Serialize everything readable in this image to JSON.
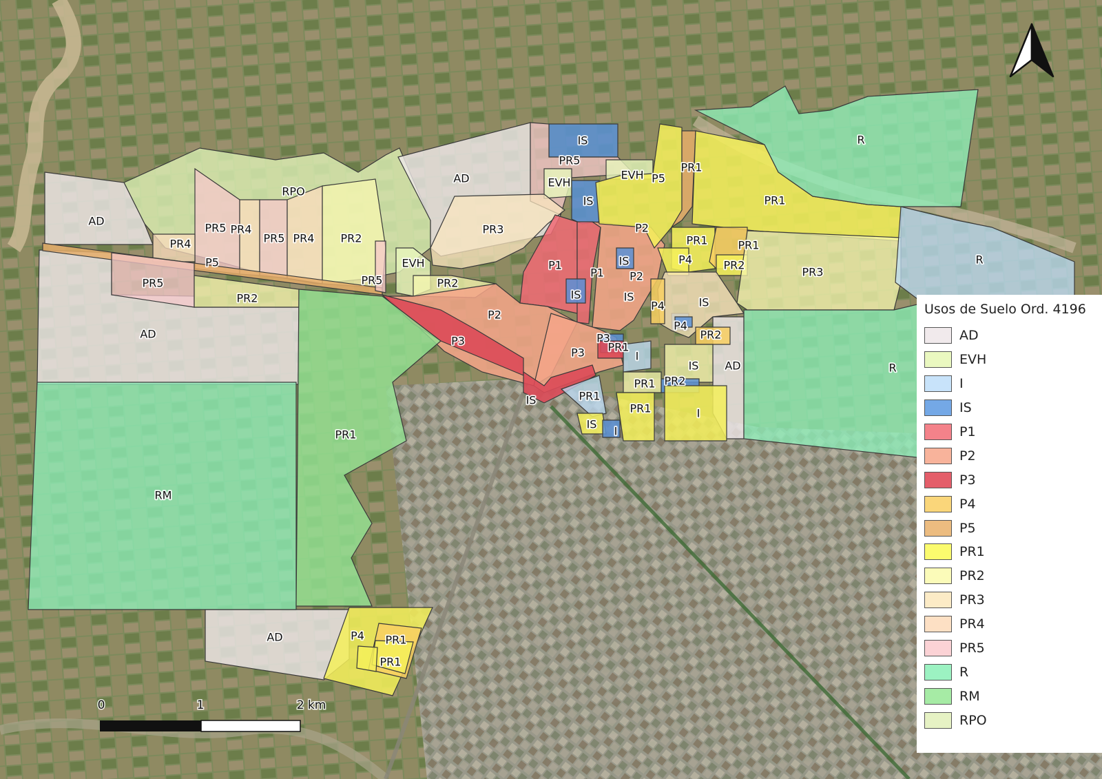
{
  "map": {
    "zones": [
      {
        "code": "RPO",
        "label": "RPO"
      },
      {
        "code": "AD",
        "label": "AD"
      },
      {
        "code": "AD",
        "label": "AD"
      },
      {
        "code": "AD",
        "label": "AD"
      },
      {
        "code": "AD",
        "label": "AD"
      },
      {
        "code": "AD",
        "label": "AD"
      },
      {
        "code": "IS",
        "label": "IS"
      },
      {
        "code": "PR5",
        "label": "PR5"
      },
      {
        "code": "EVH",
        "label": "EVH"
      },
      {
        "code": "EVH",
        "label": "EVH"
      },
      {
        "code": "EVH",
        "label": "EVH"
      },
      {
        "code": "PR5",
        "label": "PR5"
      },
      {
        "code": "PR4",
        "label": "PR4"
      },
      {
        "code": "PR5",
        "label": "PR5"
      },
      {
        "code": "PR4",
        "label": "PR4"
      },
      {
        "code": "PR2",
        "label": "PR2"
      },
      {
        "code": "PR4",
        "label": "PR4"
      },
      {
        "code": "P5",
        "label": "P5"
      },
      {
        "code": "PR5",
        "label": "PR5"
      },
      {
        "code": "PR5",
        "label": "PR5"
      },
      {
        "code": "PR2",
        "label": "PR2"
      },
      {
        "code": "PR2",
        "label": "PR2"
      },
      {
        "code": "PR3",
        "label": "PR3"
      },
      {
        "code": "IS",
        "label": "IS"
      },
      {
        "code": "P1",
        "label": "P1"
      },
      {
        "code": "P1",
        "label": "P1"
      },
      {
        "code": "P2",
        "label": "P2"
      },
      {
        "code": "P2",
        "label": "P2"
      },
      {
        "code": "P2",
        "label": "P2"
      },
      {
        "code": "P3",
        "label": "P3"
      },
      {
        "code": "P3",
        "label": "P3"
      },
      {
        "code": "IS",
        "label": "IS"
      },
      {
        "code": "IS",
        "label": "IS"
      },
      {
        "code": "IS",
        "label": "IS"
      },
      {
        "code": "IS",
        "label": "IS"
      },
      {
        "code": "P3",
        "label": "P3"
      },
      {
        "code": "PR1",
        "label": "PR1"
      },
      {
        "code": "P5",
        "label": "P5"
      },
      {
        "code": "PR1",
        "label": "PR1"
      },
      {
        "code": "PR1",
        "label": "PR1"
      },
      {
        "code": "PR1",
        "label": "PR1"
      },
      {
        "code": "P4",
        "label": "P4"
      },
      {
        "code": "PR1",
        "label": "PR1"
      },
      {
        "code": "PR2",
        "label": "PR2"
      },
      {
        "code": "PR3",
        "label": "PR3"
      },
      {
        "code": "IS",
        "label": "IS"
      },
      {
        "code": "P4",
        "label": "P4"
      },
      {
        "code": "P4",
        "label": "P4"
      },
      {
        "code": "PR2",
        "label": "PR2"
      },
      {
        "code": "IS",
        "label": "IS"
      },
      {
        "code": "PR2",
        "label": "PR2"
      },
      {
        "code": "PR1",
        "label": "PR1"
      },
      {
        "code": "PR1",
        "label": "PR1"
      },
      {
        "code": "I",
        "label": "I"
      },
      {
        "code": "I",
        "label": "I"
      },
      {
        "code": "PR1",
        "label": "PR1"
      },
      {
        "code": "IS",
        "label": "IS"
      },
      {
        "code": "I",
        "label": "I"
      },
      {
        "code": "R",
        "label": "R"
      },
      {
        "code": "R",
        "label": "R"
      },
      {
        "code": "R",
        "label": "R"
      },
      {
        "code": "RM",
        "label": "RM"
      },
      {
        "code": "PR1",
        "label": "PR1"
      },
      {
        "code": "P4",
        "label": "P4"
      },
      {
        "code": "PR1",
        "label": "PR1"
      },
      {
        "code": "PR1",
        "label": "PR1"
      }
    ]
  },
  "scale_bar": {
    "ticks": [
      "0",
      "1",
      "2 km"
    ]
  },
  "north_arrow": {
    "icon": "north-arrow-icon"
  },
  "legend": {
    "title": "Usos de Suelo Ord. 4196",
    "items": [
      {
        "code": "AD",
        "label": "AD",
        "color": "#f1eaec"
      },
      {
        "code": "EVH",
        "label": "EVH",
        "color": "#eaf8c0"
      },
      {
        "code": "I",
        "label": "I",
        "color": "#c8e3fa"
      },
      {
        "code": "IS",
        "label": "IS",
        "color": "#74a8e6"
      },
      {
        "code": "P1",
        "label": "P1",
        "color": "#f4828a"
      },
      {
        "code": "P2",
        "label": "P2",
        "color": "#f8b39b"
      },
      {
        "code": "P3",
        "label": "P3",
        "color": "#e45e6a"
      },
      {
        "code": "P4",
        "label": "P4",
        "color": "#fad67a"
      },
      {
        "code": "P5",
        "label": "P5",
        "color": "#ecbc80"
      },
      {
        "code": "PR1",
        "label": "PR1",
        "color": "#fbfb6e"
      },
      {
        "code": "PR2",
        "label": "PR2",
        "color": "#fbfbb9"
      },
      {
        "code": "PR3",
        "label": "PR3",
        "color": "#fcebc6"
      },
      {
        "code": "PR4",
        "label": "PR4",
        "color": "#fde0c4"
      },
      {
        "code": "PR5",
        "label": "PR5",
        "color": "#fbd2d5"
      },
      {
        "code": "R",
        "label": "R",
        "color": "#9cf2c2"
      },
      {
        "code": "RM",
        "label": "RM",
        "color": "#a6eba5"
      },
      {
        "code": "RPO",
        "label": "RPO",
        "color": "#e6f2c4"
      }
    ]
  }
}
